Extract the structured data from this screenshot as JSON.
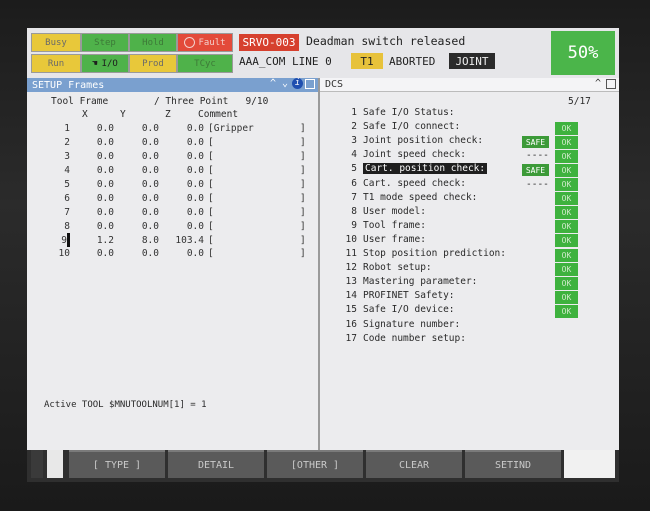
{
  "status": {
    "busy": "Busy",
    "step": "Step",
    "hold": "Hold",
    "fault": "Fault",
    "run": "Run",
    "io": "I/O",
    "prod": "Prod",
    "tcyc": "TCyc",
    "alarm_code": "SRVO-003",
    "alarm_msg": "Deadman switch released",
    "program": "AAA_COM LINE 0",
    "mode": "T1",
    "state": "ABORTED",
    "coord": "JOINT",
    "override": "50%"
  },
  "left": {
    "title": "SETUP Frames",
    "header": "Tool Frame        / Three Point   9/10",
    "cols": [
      "X",
      "Y",
      "Z",
      "Comment"
    ],
    "rows": [
      [
        "1",
        "0.0",
        "0.0",
        "0.0",
        "[Gripper",
        "]"
      ],
      [
        "2",
        "0.0",
        "0.0",
        "0.0",
        "[",
        "]"
      ],
      [
        "3",
        "0.0",
        "0.0",
        "0.0",
        "[",
        "]"
      ],
      [
        "4",
        "0.0",
        "0.0",
        "0.0",
        "[",
        "]"
      ],
      [
        "5",
        "0.0",
        "0.0",
        "0.0",
        "[",
        "]"
      ],
      [
        "6",
        "0.0",
        "0.0",
        "0.0",
        "[",
        "]"
      ],
      [
        "7",
        "0.0",
        "0.0",
        "0.0",
        "[",
        "]"
      ],
      [
        "8",
        "0.0",
        "0.0",
        "0.0",
        "[",
        "]"
      ],
      [
        "9",
        "1.2",
        "8.0",
        "103.4",
        "[",
        "]"
      ],
      [
        "10",
        "0.0",
        "0.0",
        "0.0",
        "[",
        "]"
      ]
    ],
    "footer": "Active TOOL $MNUTOOLNUM[1] = 1"
  },
  "right": {
    "title": "DCS",
    "page": "5/17",
    "items": [
      {
        "n": "1",
        "label": "Safe I/O Status:",
        "badge": "",
        "ok": ""
      },
      {
        "n": "2",
        "label": "Safe I/O connect:",
        "badge": "",
        "ok": "OK"
      },
      {
        "n": "3",
        "label": "Joint position check:",
        "badge": "SAFE",
        "ok": "OK"
      },
      {
        "n": "4",
        "label": "Joint speed check:",
        "badge": "----",
        "ok": "OK"
      },
      {
        "n": "5",
        "label": "Cart. position check:",
        "badge": "SAFE",
        "ok": "OK"
      },
      {
        "n": "6",
        "label": "Cart. speed check:",
        "badge": "----",
        "ok": "OK"
      },
      {
        "n": "7",
        "label": "T1 mode speed check:",
        "badge": "",
        "ok": "OK"
      },
      {
        "n": "8",
        "label": "User model:",
        "badge": "",
        "ok": "OK"
      },
      {
        "n": "9",
        "label": "Tool frame:",
        "badge": "",
        "ok": "OK"
      },
      {
        "n": "10",
        "label": "User frame:",
        "badge": "",
        "ok": "OK"
      },
      {
        "n": "11",
        "label": "Stop position prediction:",
        "badge": "",
        "ok": "OK"
      },
      {
        "n": "12",
        "label": "Robot setup:",
        "badge": "",
        "ok": "OK"
      },
      {
        "n": "13",
        "label": "Mastering parameter:",
        "badge": "",
        "ok": "OK"
      },
      {
        "n": "14",
        "label": "PROFINET Safety:",
        "badge": "",
        "ok": "OK"
      },
      {
        "n": "15",
        "label": "Safe I/O device:",
        "badge": "",
        "ok": "OK"
      },
      {
        "n": "16",
        "label": "Signature number:",
        "badge": "",
        "ok": ""
      },
      {
        "n": "17",
        "label": "Code number setup:",
        "badge": "",
        "ok": ""
      }
    ]
  },
  "fkeys": {
    "f1": "[ TYPE ]",
    "f2": "DETAIL",
    "f3": "[OTHER ]",
    "f4": "CLEAR",
    "f5": "SETIND"
  },
  "colors": {
    "ok": "#3eb23e",
    "fault": "#e34a3a",
    "title_bar": "#7aa0cf",
    "highlight": "#1f1f1f"
  }
}
